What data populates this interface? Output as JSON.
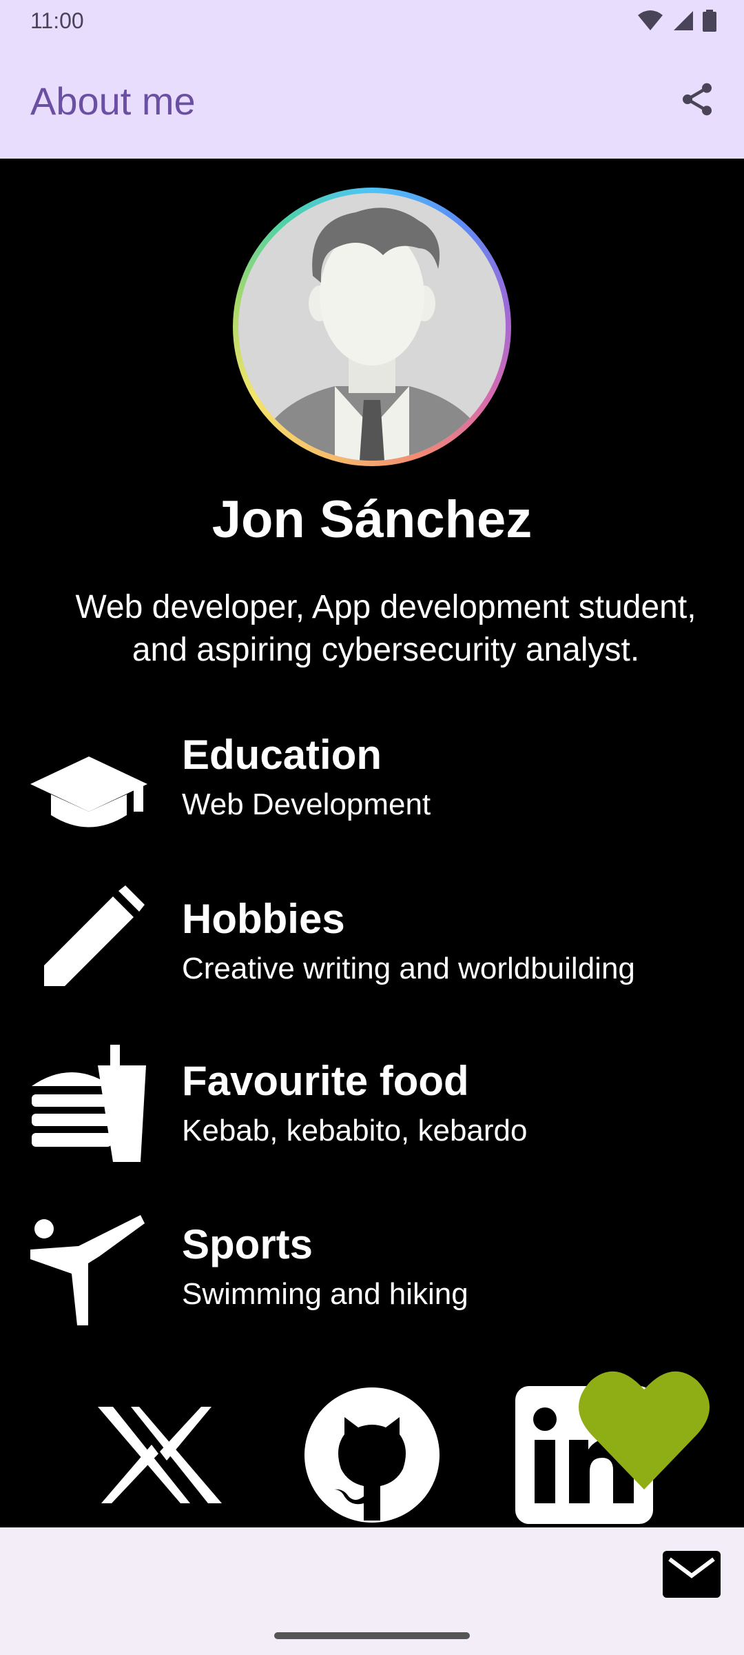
{
  "status_bar": {
    "time": "11:00"
  },
  "app_bar": {
    "title": "About me"
  },
  "profile": {
    "name": "Jon Sánchez",
    "bio_line1": "Web developer, App development student,",
    "bio_line2": "and aspiring cybersecurity analyst."
  },
  "info": [
    {
      "title": "Education",
      "subtitle": "Web Development",
      "icon": "graduation-cap-icon"
    },
    {
      "title": "Hobbies",
      "subtitle": "Creative writing and worldbuilding",
      "icon": "pencil-icon"
    },
    {
      "title": "Favourite food",
      "subtitle": "Kebab, kebabito, kebardo",
      "icon": "fastfood-icon"
    },
    {
      "title": "Sports",
      "subtitle": "Swimming and hiking",
      "icon": "martial-arts-icon"
    }
  ],
  "social": [
    "x-icon",
    "github-icon",
    "linkedin-icon"
  ],
  "colors": {
    "appbar": "#E9DDFD",
    "title": "#6B4FA3",
    "heart": "#8FAE16",
    "bottom": "#F3EDF7"
  }
}
